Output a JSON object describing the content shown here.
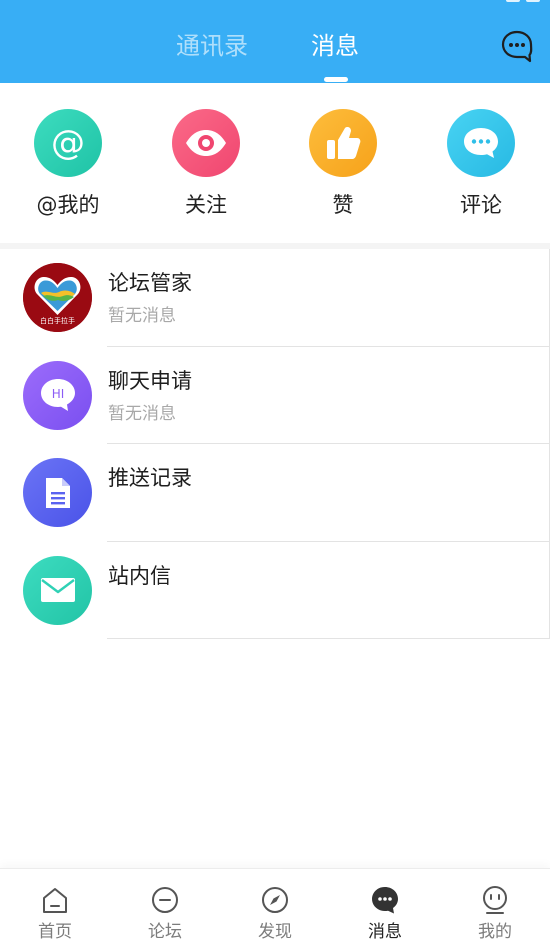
{
  "header": {
    "tabs": [
      {
        "label": "通讯录",
        "active": false
      },
      {
        "label": "消息",
        "active": true
      }
    ],
    "right_icon": "chat-bubble-dots-icon",
    "background_color": "#38aef5"
  },
  "quick_actions": [
    {
      "label": "@我的",
      "icon": "at-sign-icon",
      "color": "#2ed3b4"
    },
    {
      "label": "关注",
      "icon": "eye-icon",
      "color": "#f5587a"
    },
    {
      "label": "赞",
      "icon": "thumbs-up-icon",
      "color": "#fbb028"
    },
    {
      "label": "评论",
      "icon": "comment-dots-icon",
      "color": "#36c6ec"
    }
  ],
  "messages": [
    {
      "title": "论坛管家",
      "subtitle": "暂无消息",
      "avatar": "heart-hands-logo-avatar",
      "avatar_text": "白白手拉手"
    },
    {
      "title": "聊天申请",
      "subtitle": "暂无消息",
      "avatar": "hi-chat-bubble-icon",
      "avatar_text": "HI",
      "color": "#8c5cf5"
    },
    {
      "title": "推送记录",
      "subtitle": "",
      "avatar": "document-icon",
      "color": "#5a63f0"
    },
    {
      "title": "站内信",
      "subtitle": "",
      "avatar": "envelope-icon",
      "color": "#2fd1b5"
    }
  ],
  "bottom_nav": [
    {
      "label": "首页",
      "icon": "home-icon",
      "active": false
    },
    {
      "label": "论坛",
      "icon": "forum-icon",
      "active": false
    },
    {
      "label": "发现",
      "icon": "compass-icon",
      "active": false
    },
    {
      "label": "消息",
      "icon": "message-bubble-icon",
      "active": true
    },
    {
      "label": "我的",
      "icon": "profile-face-icon",
      "active": false
    }
  ]
}
